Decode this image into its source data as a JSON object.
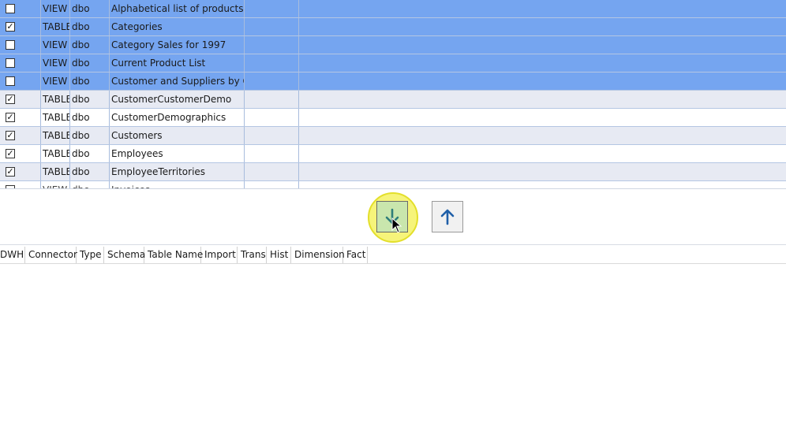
{
  "top_grid": {
    "rows": [
      {
        "checked": false,
        "type": "VIEW",
        "schema": "dbo",
        "name": "Alphabetical list of products",
        "style": "selected"
      },
      {
        "checked": true,
        "type": "TABLE",
        "schema": "dbo",
        "name": "Categories",
        "style": "selected"
      },
      {
        "checked": false,
        "type": "VIEW",
        "schema": "dbo",
        "name": "Category Sales for 1997",
        "style": "selected"
      },
      {
        "checked": false,
        "type": "VIEW",
        "schema": "dbo",
        "name": "Current Product List",
        "style": "selected"
      },
      {
        "checked": false,
        "type": "VIEW",
        "schema": "dbo",
        "name": "Customer and Suppliers by City",
        "style": "selected"
      },
      {
        "checked": true,
        "type": "TABLE",
        "schema": "dbo",
        "name": "CustomerCustomerDemo",
        "style": "alt"
      },
      {
        "checked": true,
        "type": "TABLE",
        "schema": "dbo",
        "name": "CustomerDemographics",
        "style": "plain"
      },
      {
        "checked": true,
        "type": "TABLE",
        "schema": "dbo",
        "name": "Customers",
        "style": "alt"
      },
      {
        "checked": true,
        "type": "TABLE",
        "schema": "dbo",
        "name": "Employees",
        "style": "plain"
      },
      {
        "checked": true,
        "type": "TABLE",
        "schema": "dbo",
        "name": "EmployeeTerritories",
        "style": "alt"
      },
      {
        "checked": false,
        "type": "VIEW",
        "schema": "dbo",
        "name": "Invoices",
        "style": "plain"
      }
    ],
    "check_mark": "✓"
  },
  "buttons": {
    "move_down_icon": "arrow-down-icon",
    "move_up_icon": "arrow-up-icon"
  },
  "bottom_grid": {
    "headers": [
      "DWH",
      "Connector",
      "Type",
      "Schema",
      "Table Name",
      "Import",
      "Trans",
      "Hist",
      "Dimension",
      "Fact"
    ]
  },
  "colors": {
    "selected_row": "#75a5f0",
    "alt_row": "#e7eaf3",
    "highlight": "#f6f47a",
    "down_button": "#c9e6ad",
    "arrow_down": "#2e7d7a",
    "arrow_up": "#1f5fa8"
  }
}
